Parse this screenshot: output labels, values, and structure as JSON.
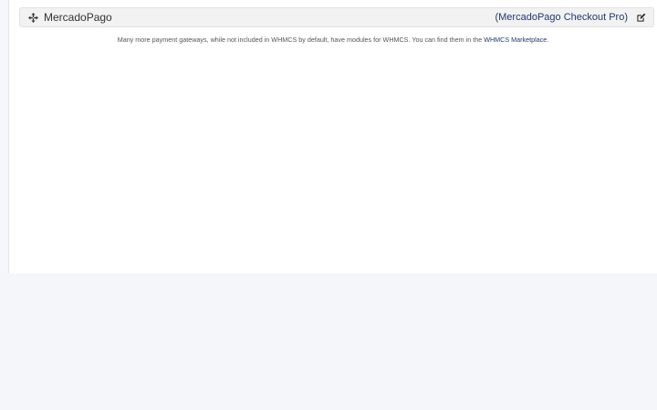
{
  "gateway": {
    "name": "MercadoPago",
    "module_label": "(MercadoPago Checkout Pro)"
  },
  "icons": {
    "drag": "move-arrows-icon",
    "edit": "edit-square-icon"
  },
  "note": {
    "text_before": "Many more payment gateways, while not included in WHMCS by default, have modules for WHMCS. You can find them in the ",
    "link_text": "WHMCS Marketplace",
    "text_after": "."
  },
  "colors": {
    "link": "#1f3a6e",
    "row_background": "#f2f2f2",
    "page_background": "#f5f6fa"
  }
}
